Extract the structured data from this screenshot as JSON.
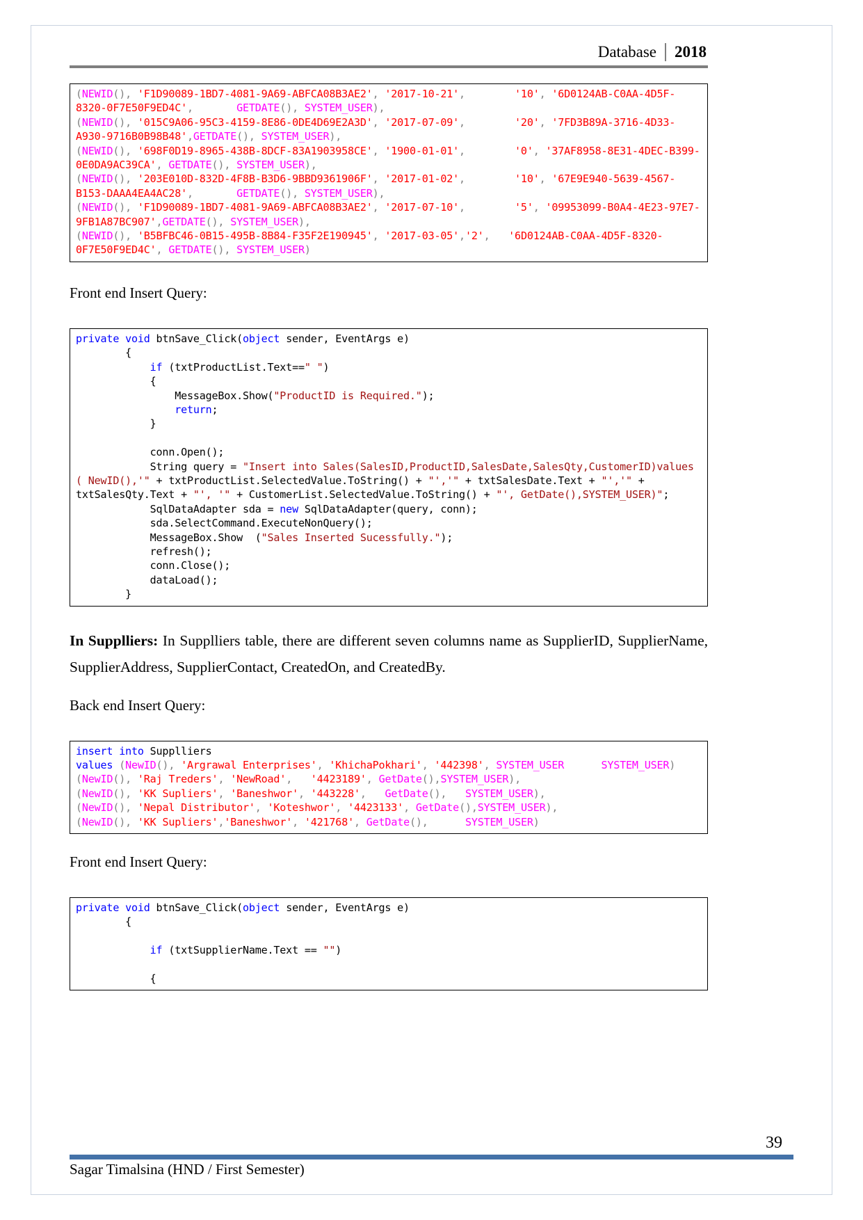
{
  "header": {
    "left_label": "Database",
    "year": "2018"
  },
  "blocks": {
    "sales_back_end_sql": [
      [
        {
          "t": "(",
          "c": "sql-punct"
        },
        {
          "t": "NEWID",
          "c": "sql-fn"
        },
        {
          "t": "(), ",
          "c": "sql-punct"
        },
        {
          "t": "'F1D90089-1BD7-4081-9A69-ABFCA08B3AE2'",
          "c": "sql-str"
        },
        {
          "t": ", ",
          "c": "sql-punct"
        },
        {
          "t": "'2017-10-21'",
          "c": "sql-str"
        },
        {
          "t": ",        ",
          "c": "sql-punct"
        },
        {
          "t": "'10'",
          "c": "sql-str"
        },
        {
          "t": ", ",
          "c": "sql-punct"
        },
        {
          "t": "'6D0124AB-C0AA-4D5F-8320-0F7E50F9ED4C'",
          "c": "sql-str"
        },
        {
          "t": ",       ",
          "c": "sql-punct"
        },
        {
          "t": "GETDATE",
          "c": "sql-fn"
        },
        {
          "t": "(), ",
          "c": "sql-punct"
        },
        {
          "t": "SYSTEM_USER",
          "c": "sql-fn"
        },
        {
          "t": "),",
          "c": "sql-punct"
        }
      ],
      [
        {
          "t": "(",
          "c": "sql-punct"
        },
        {
          "t": "NEWID",
          "c": "sql-fn"
        },
        {
          "t": "(), ",
          "c": "sql-punct"
        },
        {
          "t": "'015C9A06-95C3-4159-8E86-0DE4D69E2A3D'",
          "c": "sql-str"
        },
        {
          "t": ", ",
          "c": "sql-punct"
        },
        {
          "t": "'2017-07-09'",
          "c": "sql-str"
        },
        {
          "t": ",        ",
          "c": "sql-punct"
        },
        {
          "t": "'20'",
          "c": "sql-str"
        },
        {
          "t": ", ",
          "c": "sql-punct"
        },
        {
          "t": "'7FD3B89A-3716-4D33-A930-9716B0B98B48'",
          "c": "sql-str"
        },
        {
          "t": ",",
          "c": "sql-punct"
        },
        {
          "t": "GETDATE",
          "c": "sql-fn"
        },
        {
          "t": "(), ",
          "c": "sql-punct"
        },
        {
          "t": "SYSTEM_USER",
          "c": "sql-fn"
        },
        {
          "t": "),",
          "c": "sql-punct"
        }
      ],
      [
        {
          "t": "(",
          "c": "sql-punct"
        },
        {
          "t": "NEWID",
          "c": "sql-fn"
        },
        {
          "t": "(), ",
          "c": "sql-punct"
        },
        {
          "t": "'698F0D19-8965-438B-8DCF-83A1903958CE'",
          "c": "sql-str"
        },
        {
          "t": ", ",
          "c": "sql-punct"
        },
        {
          "t": "'1900-01-01'",
          "c": "sql-str"
        },
        {
          "t": ",        ",
          "c": "sql-punct"
        },
        {
          "t": "'0'",
          "c": "sql-str"
        },
        {
          "t": ", ",
          "c": "sql-punct"
        },
        {
          "t": "'37AF8958-8E31-4DEC-B399-0E0DA9AC39CA'",
          "c": "sql-str"
        },
        {
          "t": ", ",
          "c": "sql-punct"
        },
        {
          "t": "GETDATE",
          "c": "sql-fn"
        },
        {
          "t": "(), ",
          "c": "sql-punct"
        },
        {
          "t": "SYSTEM_USER",
          "c": "sql-fn"
        },
        {
          "t": "),",
          "c": "sql-punct"
        }
      ],
      [
        {
          "t": "(",
          "c": "sql-punct"
        },
        {
          "t": "NEWID",
          "c": "sql-fn"
        },
        {
          "t": "(), ",
          "c": "sql-punct"
        },
        {
          "t": "'203E010D-832D-4F8B-B3D6-9BBD9361906F'",
          "c": "sql-str"
        },
        {
          "t": ", ",
          "c": "sql-punct"
        },
        {
          "t": "'2017-01-02'",
          "c": "sql-str"
        },
        {
          "t": ",        ",
          "c": "sql-punct"
        },
        {
          "t": "'10'",
          "c": "sql-str"
        },
        {
          "t": ", ",
          "c": "sql-punct"
        },
        {
          "t": "'67E9E940-5639-4567-B153-DAAA4EA4AC28'",
          "c": "sql-str"
        },
        {
          "t": ",       ",
          "c": "sql-punct"
        },
        {
          "t": "GETDATE",
          "c": "sql-fn"
        },
        {
          "t": "(), ",
          "c": "sql-punct"
        },
        {
          "t": "SYSTEM_USER",
          "c": "sql-fn"
        },
        {
          "t": "),",
          "c": "sql-punct"
        }
      ],
      [
        {
          "t": "(",
          "c": "sql-punct"
        },
        {
          "t": "NEWID",
          "c": "sql-fn"
        },
        {
          "t": "(), ",
          "c": "sql-punct"
        },
        {
          "t": "'F1D90089-1BD7-4081-9A69-ABFCA08B3AE2'",
          "c": "sql-str"
        },
        {
          "t": ", ",
          "c": "sql-punct"
        },
        {
          "t": "'2017-07-10'",
          "c": "sql-str"
        },
        {
          "t": ",        ",
          "c": "sql-punct"
        },
        {
          "t": "'5'",
          "c": "sql-str"
        },
        {
          "t": ", ",
          "c": "sql-punct"
        },
        {
          "t": "'09953099-B0A4-4E23-97E7-9FB1A87BC907'",
          "c": "sql-str"
        },
        {
          "t": ",",
          "c": "sql-punct"
        },
        {
          "t": "GETDATE",
          "c": "sql-fn"
        },
        {
          "t": "(), ",
          "c": "sql-punct"
        },
        {
          "t": "SYSTEM_USER",
          "c": "sql-fn"
        },
        {
          "t": "),",
          "c": "sql-punct"
        }
      ],
      [
        {
          "t": "(",
          "c": "sql-punct"
        },
        {
          "t": "NEWID",
          "c": "sql-fn"
        },
        {
          "t": "(), ",
          "c": "sql-punct"
        },
        {
          "t": "'B5BFBC46-0B15-495B-8B84-F35F2E190945'",
          "c": "sql-str"
        },
        {
          "t": ", ",
          "c": "sql-punct"
        },
        {
          "t": "'2017-03-05'",
          "c": "sql-str"
        },
        {
          "t": ",",
          "c": "sql-punct"
        },
        {
          "t": "'2'",
          "c": "sql-str"
        },
        {
          "t": ",   ",
          "c": "sql-punct"
        },
        {
          "t": "'6D0124AB-C0AA-4D5F-8320-0F7E50F9ED4C'",
          "c": "sql-str"
        },
        {
          "t": ", ",
          "c": "sql-punct"
        },
        {
          "t": "GETDATE",
          "c": "sql-fn"
        },
        {
          "t": "(), ",
          "c": "sql-punct"
        },
        {
          "t": "SYSTEM_USER",
          "c": "sql-fn"
        },
        {
          "t": ")",
          "c": "sql-punct"
        }
      ]
    ],
    "sales_front_end_label": "Front end Insert Query:",
    "sales_front_end_code": [
      [
        {
          "t": "private",
          "c": "cs-kw"
        },
        {
          "t": " ",
          "c": "cs-plain"
        },
        {
          "t": "void",
          "c": "cs-kw"
        },
        {
          "t": " btnSave_Click(",
          "c": "cs-plain"
        },
        {
          "t": "object",
          "c": "cs-kw"
        },
        {
          "t": " sender, EventArgs e)",
          "c": "cs-plain"
        }
      ],
      [
        {
          "t": "        {",
          "c": "cs-plain"
        }
      ],
      [
        {
          "t": "            ",
          "c": "cs-plain"
        },
        {
          "t": "if",
          "c": "cs-kw"
        },
        {
          "t": " (txtProductList.Text==",
          "c": "cs-plain"
        },
        {
          "t": "\" \"",
          "c": "cs-str"
        },
        {
          "t": ")",
          "c": "cs-plain"
        }
      ],
      [
        {
          "t": "            {",
          "c": "cs-plain"
        }
      ],
      [
        {
          "t": "                MessageBox.Show(",
          "c": "cs-plain"
        },
        {
          "t": "\"ProductID is Required.\"",
          "c": "cs-str"
        },
        {
          "t": ");",
          "c": "cs-plain"
        }
      ],
      [
        {
          "t": "                ",
          "c": "cs-plain"
        },
        {
          "t": "return",
          "c": "cs-kw"
        },
        {
          "t": ";",
          "c": "cs-plain"
        }
      ],
      [
        {
          "t": "            }",
          "c": "cs-plain"
        }
      ],
      [
        {
          "t": "",
          "c": "cs-plain"
        }
      ],
      [
        {
          "t": "            conn.Open();",
          "c": "cs-plain"
        }
      ],
      [
        {
          "t": "            String query = ",
          "c": "cs-plain"
        },
        {
          "t": "\"Insert into Sales(SalesID,ProductID,SalesDate,SalesQty,CustomerID)values ( NewID(),'\"",
          "c": "cs-str"
        },
        {
          "t": " + txtProductList.SelectedValue.ToString() + ",
          "c": "cs-plain"
        },
        {
          "t": "\"','\"",
          "c": "cs-str"
        },
        {
          "t": " + txtSalesDate.Text + ",
          "c": "cs-plain"
        },
        {
          "t": "\"','\"",
          "c": "cs-str"
        },
        {
          "t": " + txtSalesQty.Text + ",
          "c": "cs-plain"
        },
        {
          "t": "\"', '\"",
          "c": "cs-str"
        },
        {
          "t": " + CustomerList.SelectedValue.ToString() + ",
          "c": "cs-plain"
        },
        {
          "t": "\"', GetDate(),SYSTEM_USER)\"",
          "c": "cs-str"
        },
        {
          "t": ";",
          "c": "cs-plain"
        }
      ],
      [
        {
          "t": "            SqlDataAdapter sda = ",
          "c": "cs-plain"
        },
        {
          "t": "new",
          "c": "cs-kw"
        },
        {
          "t": " SqlDataAdapter(query, conn);",
          "c": "cs-plain"
        }
      ],
      [
        {
          "t": "            sda.SelectCommand.ExecuteNonQuery();",
          "c": "cs-plain"
        }
      ],
      [
        {
          "t": "            MessageBox.Show  (",
          "c": "cs-plain"
        },
        {
          "t": "\"Sales Inserted Sucessfully.\"",
          "c": "cs-str"
        },
        {
          "t": ");",
          "c": "cs-plain"
        }
      ],
      [
        {
          "t": "            refresh();",
          "c": "cs-plain"
        }
      ],
      [
        {
          "t": "            conn.Close();",
          "c": "cs-plain"
        }
      ],
      [
        {
          "t": "            dataLoad();",
          "c": "cs-plain"
        }
      ],
      [
        {
          "t": "        }",
          "c": "cs-plain"
        }
      ]
    ],
    "suppliers_paragraph_bold": "In  Supplliers:",
    "suppliers_paragraph_rest": " In  Supplliers  table,  there  are  different  seven  columns  name  as  SupplierID, SupplierName, SupplierAddress, SupplierContact, CreatedOn, and CreatedBy.",
    "suppliers_back_end_label": "Back end Insert Query:",
    "suppliers_back_end_sql": [
      [
        {
          "t": "insert into",
          "c": "sql-kw"
        },
        {
          "t": " Supplliers",
          "c": "sql-plain"
        }
      ],
      [
        {
          "t": "values",
          "c": "sql-kw"
        },
        {
          "t": " (",
          "c": "sql-punct"
        },
        {
          "t": "NewID",
          "c": "sql-fn"
        },
        {
          "t": "(), ",
          "c": "sql-punct"
        },
        {
          "t": "'Argrawal Enterprises'",
          "c": "sql-str"
        },
        {
          "t": ", ",
          "c": "sql-punct"
        },
        {
          "t": "'KhichaPokhari'",
          "c": "sql-str"
        },
        {
          "t": ", ",
          "c": "sql-punct"
        },
        {
          "t": "'442398'",
          "c": "sql-str"
        },
        {
          "t": ", ",
          "c": "sql-punct"
        },
        {
          "t": "SYSTEM_USER",
          "c": "sql-fn"
        },
        {
          "t": "      ",
          "c": "sql-punct"
        },
        {
          "t": "SYSTEM_USER",
          "c": "sql-fn"
        },
        {
          "t": ")",
          "c": "sql-punct"
        }
      ],
      [
        {
          "t": "(",
          "c": "sql-punct"
        },
        {
          "t": "NewID",
          "c": "sql-fn"
        },
        {
          "t": "(), ",
          "c": "sql-punct"
        },
        {
          "t": "'Raj Treders'",
          "c": "sql-str"
        },
        {
          "t": ", ",
          "c": "sql-punct"
        },
        {
          "t": "'NewRoad'",
          "c": "sql-str"
        },
        {
          "t": ",   ",
          "c": "sql-punct"
        },
        {
          "t": "'4423189'",
          "c": "sql-str"
        },
        {
          "t": ", ",
          "c": "sql-punct"
        },
        {
          "t": "GetDate",
          "c": "sql-fn"
        },
        {
          "t": "(),",
          "c": "sql-punct"
        },
        {
          "t": "SYSTEM_USER",
          "c": "sql-fn"
        },
        {
          "t": "),",
          "c": "sql-punct"
        }
      ],
      [
        {
          "t": "(",
          "c": "sql-punct"
        },
        {
          "t": "NewID",
          "c": "sql-fn"
        },
        {
          "t": "(), ",
          "c": "sql-punct"
        },
        {
          "t": "'KK Supliers'",
          "c": "sql-str"
        },
        {
          "t": ", ",
          "c": "sql-punct"
        },
        {
          "t": "'Baneshwor'",
          "c": "sql-str"
        },
        {
          "t": ", ",
          "c": "sql-punct"
        },
        {
          "t": "'443228'",
          "c": "sql-str"
        },
        {
          "t": ",   ",
          "c": "sql-punct"
        },
        {
          "t": "GetDate",
          "c": "sql-fn"
        },
        {
          "t": "(),   ",
          "c": "sql-punct"
        },
        {
          "t": "SYSTEM_USER",
          "c": "sql-fn"
        },
        {
          "t": "),",
          "c": "sql-punct"
        }
      ],
      [
        {
          "t": "(",
          "c": "sql-punct"
        },
        {
          "t": "NewID",
          "c": "sql-fn"
        },
        {
          "t": "(), ",
          "c": "sql-punct"
        },
        {
          "t": "'Nepal Distributor'",
          "c": "sql-str"
        },
        {
          "t": ", ",
          "c": "sql-punct"
        },
        {
          "t": "'Koteshwor'",
          "c": "sql-str"
        },
        {
          "t": ", ",
          "c": "sql-punct"
        },
        {
          "t": "'4423133'",
          "c": "sql-str"
        },
        {
          "t": ", ",
          "c": "sql-punct"
        },
        {
          "t": "GetDate",
          "c": "sql-fn"
        },
        {
          "t": "(),",
          "c": "sql-punct"
        },
        {
          "t": "SYSTEM_USER",
          "c": "sql-fn"
        },
        {
          "t": "),",
          "c": "sql-punct"
        }
      ],
      [
        {
          "t": "(",
          "c": "sql-punct"
        },
        {
          "t": "NewID",
          "c": "sql-fn"
        },
        {
          "t": "(), ",
          "c": "sql-punct"
        },
        {
          "t": "'KK Supliers'",
          "c": "sql-str"
        },
        {
          "t": ",",
          "c": "sql-punct"
        },
        {
          "t": "'Baneshwor'",
          "c": "sql-str"
        },
        {
          "t": ", ",
          "c": "sql-punct"
        },
        {
          "t": "'421768'",
          "c": "sql-str"
        },
        {
          "t": ", ",
          "c": "sql-punct"
        },
        {
          "t": "GetDate",
          "c": "sql-fn"
        },
        {
          "t": "(),      ",
          "c": "sql-punct"
        },
        {
          "t": "SYSTEM_USER",
          "c": "sql-fn"
        },
        {
          "t": ")",
          "c": "sql-punct"
        }
      ]
    ],
    "suppliers_front_end_label": "Front end Insert Query:",
    "suppliers_front_end_code": [
      [
        {
          "t": "private",
          "c": "cs-kw"
        },
        {
          "t": " ",
          "c": "cs-plain"
        },
        {
          "t": "void",
          "c": "cs-kw"
        },
        {
          "t": " btnSave_Click(",
          "c": "cs-plain"
        },
        {
          "t": "object",
          "c": "cs-kw"
        },
        {
          "t": " sender, EventArgs e)",
          "c": "cs-plain"
        }
      ],
      [
        {
          "t": "        {",
          "c": "cs-plain"
        }
      ],
      [
        {
          "t": "",
          "c": "cs-plain"
        }
      ],
      [
        {
          "t": "            ",
          "c": "cs-plain"
        },
        {
          "t": "if",
          "c": "cs-kw"
        },
        {
          "t": " (txtSupplierName.Text == ",
          "c": "cs-plain"
        },
        {
          "t": "\"\"",
          "c": "cs-str"
        },
        {
          "t": ")",
          "c": "cs-plain"
        }
      ],
      [
        {
          "t": "",
          "c": "cs-plain"
        }
      ],
      [
        {
          "t": "            {",
          "c": "cs-plain"
        }
      ]
    ]
  },
  "footer": {
    "author": "Sagar Timalsina (HND / First Semester)",
    "page_number": "39"
  },
  "colors": {
    "sql_string": "#ff0000",
    "sql_function": "#ff00ff",
    "sql_punct": "#808080",
    "sql_keyword": "#0000ff",
    "cs_keyword": "#0000ff",
    "cs_string": "#a31515",
    "header_rule": "#7f7f7f",
    "footer_rule": "#4472a8",
    "page_border": "#c9d3e0"
  }
}
